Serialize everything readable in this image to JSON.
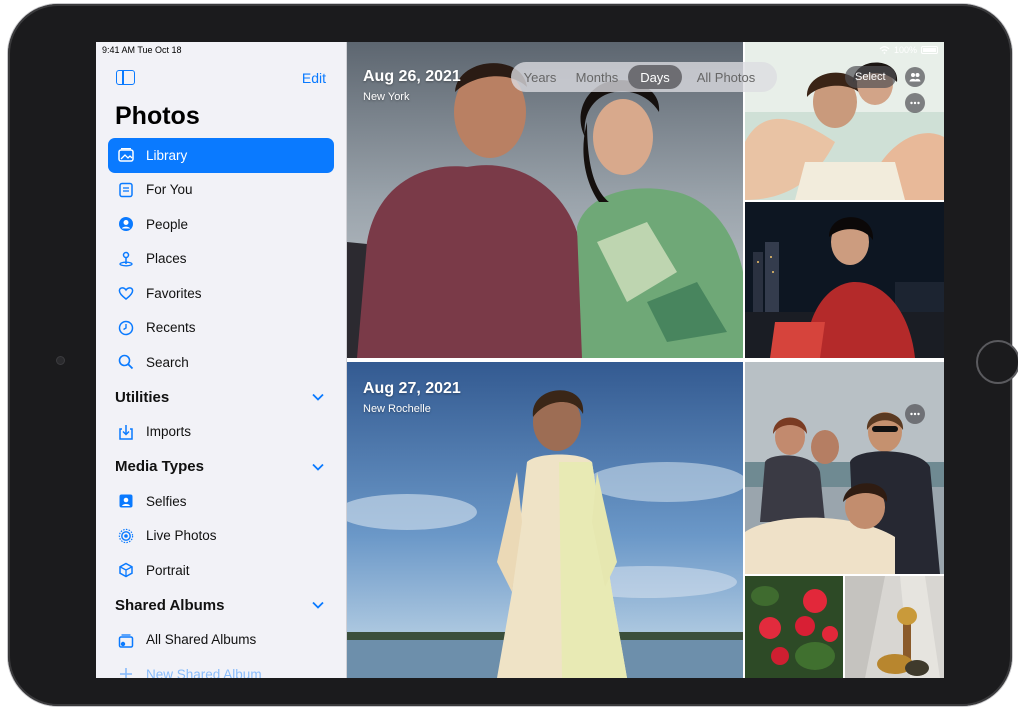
{
  "status": {
    "time_date": "9:41 AM  Tue Oct 18",
    "battery": "100%"
  },
  "sidebar": {
    "edit_label": "Edit",
    "title": "Photos",
    "items": [
      {
        "label": "Library",
        "icon": "library-icon",
        "selected": true
      },
      {
        "label": "For You",
        "icon": "for-you-icon"
      },
      {
        "label": "People",
        "icon": "people-icon"
      },
      {
        "label": "Places",
        "icon": "places-icon"
      },
      {
        "label": "Favorites",
        "icon": "heart-icon"
      },
      {
        "label": "Recents",
        "icon": "clock-icon"
      },
      {
        "label": "Search",
        "icon": "search-icon"
      }
    ],
    "utilities": {
      "title": "Utilities",
      "items": [
        {
          "label": "Imports",
          "icon": "imports-icon"
        }
      ]
    },
    "media_types": {
      "title": "Media Types",
      "items": [
        {
          "label": "Selfies",
          "icon": "selfies-icon"
        },
        {
          "label": "Live Photos",
          "icon": "live-photos-icon"
        },
        {
          "label": "Portrait",
          "icon": "portrait-icon"
        }
      ]
    },
    "shared_albums": {
      "title": "Shared Albums",
      "items": [
        {
          "label": "All Shared Albums",
          "icon": "shared-albums-icon"
        },
        {
          "label": "New Shared Album",
          "icon": "plus-icon"
        }
      ]
    }
  },
  "toolbar": {
    "tabs": [
      "Years",
      "Months",
      "Days",
      "All Photos"
    ],
    "active_tab": "Days",
    "select_label": "Select"
  },
  "groups": [
    {
      "date": "Aug 26, 2021",
      "place": "New York"
    },
    {
      "date": "Aug 27, 2021",
      "place": "New Rochelle"
    }
  ],
  "colors": {
    "accent": "#0a7aff",
    "sidebar_bg": "#f2f2f7"
  }
}
